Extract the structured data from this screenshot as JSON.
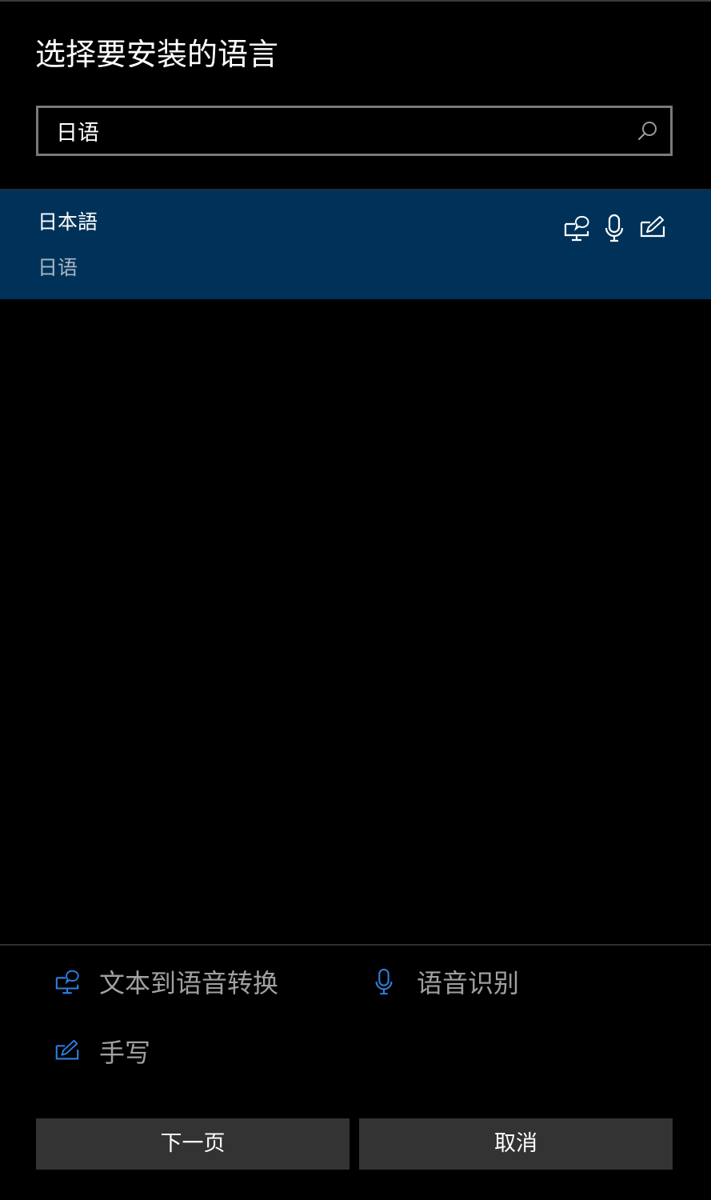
{
  "dialog": {
    "title": "选择要安装的语言"
  },
  "search": {
    "value": "日语",
    "placeholder": ""
  },
  "results": [
    {
      "native_name": "日本語",
      "localized_name": "日语",
      "selected": true,
      "features": [
        "text-to-speech-icon",
        "microphone-icon",
        "handwriting-icon"
      ]
    }
  ],
  "legend": {
    "tts_label": "文本到语音转换",
    "speech_label": "语音识别",
    "handwriting_label": "手写"
  },
  "buttons": {
    "next_label": "下一页",
    "cancel_label": "取消"
  },
  "colors": {
    "background": "#000000",
    "selected_row": "#003259",
    "accent": "#2f7fe0",
    "button": "#333333",
    "secondary_text": "#a0a0a0"
  }
}
